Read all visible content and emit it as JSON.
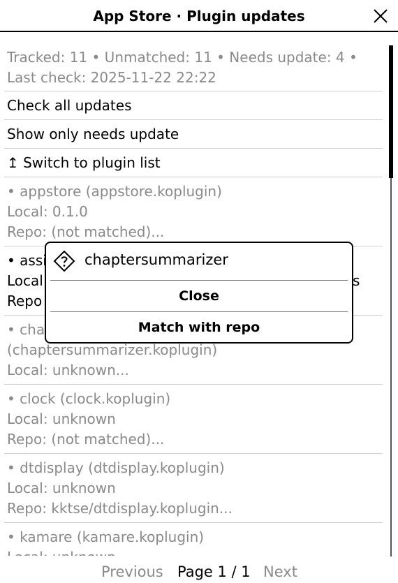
{
  "header": {
    "title": "App Store · Plugin updates",
    "close_icon": "close-icon"
  },
  "summary": {
    "line1": "Tracked: 11 • Unmatched: 11 • Needs update: 4 •",
    "line2": "Last check: 2025-11-22 22:22"
  },
  "actions": {
    "check_all": "Check all updates",
    "show_needs_update": "Show only needs update",
    "switch_to_list": "↥ Switch to plugin list"
  },
  "plugins": [
    {
      "name_line": "• appstore (appstore.koplugin)",
      "local": "Local: 0.1.0",
      "repo": "Repo: (not matched)..."
    },
    {
      "name_line": "• assi",
      "local": "Local",
      "repo": "Repo",
      "right_fragment": "s"
    },
    {
      "name_line": "• cha",
      "name_line2": "(chaptersummarizer.koplugin)",
      "local": "Local: unknown..."
    },
    {
      "name_line": "• clock (clock.koplugin)",
      "local": "Local: unknown",
      "repo": "Repo: (not matched)..."
    },
    {
      "name_line": "• dtdisplay (dtdisplay.koplugin)",
      "local": "Local: unknown",
      "repo": "Repo: kktse/dtdisplay.koplugin..."
    },
    {
      "name_line": "• kamare (kamare.koplugin)",
      "local": "Local: unknown"
    }
  ],
  "footer": {
    "previous": "Previous",
    "page": "Page 1 / 1",
    "next": "Next"
  },
  "dialog": {
    "title": "chaptersummarizer",
    "icon": "diamond-question-icon",
    "close_label": "Close",
    "match_label": "Match with repo"
  }
}
